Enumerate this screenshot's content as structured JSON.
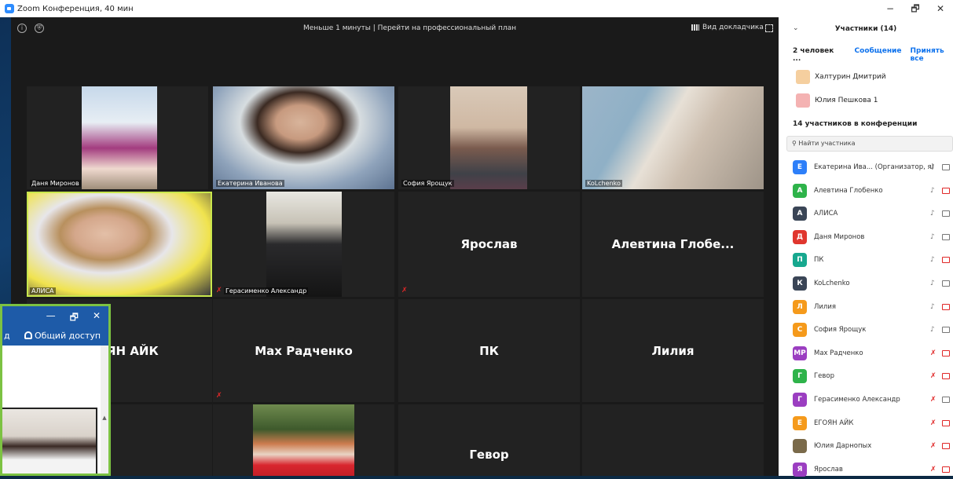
{
  "window": {
    "title": "Zoom Конференция, 40 мин",
    "minimize": "−",
    "maximize": "🗗",
    "close": "✕"
  },
  "meeting": {
    "info_icon": "i",
    "shield_icon": "⛨",
    "upgrade_msg": "Меньше 1 минуты | Перейти на профессиональный план",
    "speaker_view": "Вид докладчика"
  },
  "tiles": [
    {
      "name": "Даня Миронов"
    },
    {
      "name": "Екатерина Иванова"
    },
    {
      "name": "София Ярощук"
    },
    {
      "name": "KoLchenko"
    },
    {
      "name": "АЛИСА"
    },
    {
      "name": "Герасименко Александр"
    },
    {
      "center": "Ярослав"
    },
    {
      "center": "Алевтина  Глобе..."
    },
    {
      "center": "ЯН АЙК"
    },
    {
      "center": "Max Радченко"
    },
    {
      "center": "ПК"
    },
    {
      "center": "Лилия"
    },
    {
      "center": "Гевор"
    }
  ],
  "panel": {
    "title": "Участники (14)",
    "waiting_count": "2 человек ...",
    "message": "Сообщение",
    "admit_all": "Принять все",
    "waiting": [
      "Халтурин Дмитрий",
      "Юлия Пешкова 1"
    ],
    "in_conf": "14 участников в конференции",
    "search_placeholder": "Найти участника",
    "participants": [
      {
        "initial": "Е",
        "name": "Екатерина Ива... (Организатор, я)",
        "color": "#2d7ff9",
        "mic": "on",
        "cam": "on"
      },
      {
        "initial": "А",
        "name": "Алевтина Глобенко",
        "color": "#2eb34a",
        "mic": "on",
        "cam": "off"
      },
      {
        "initial": "А",
        "name": "АЛИСА",
        "color": "#3a4556",
        "mic": "on",
        "cam": "on"
      },
      {
        "initial": "Д",
        "name": "Даня Миронов",
        "color": "#e0362e",
        "mic": "on",
        "cam": "on"
      },
      {
        "initial": "П",
        "name": "ПК",
        "color": "#17a88f",
        "mic": "on",
        "cam": "off"
      },
      {
        "initial": "К",
        "name": "KoLchenko",
        "color": "#3a4556",
        "mic": "on",
        "cam": "on"
      },
      {
        "initial": "Л",
        "name": "Лилия",
        "color": "#f59a1b",
        "mic": "on",
        "cam": "off"
      },
      {
        "initial": "С",
        "name": "София Ярощук",
        "color": "#f59a1b",
        "mic": "on",
        "cam": "on"
      },
      {
        "initial": "MP",
        "name": "Max Радченко",
        "color": "#9b3ec1",
        "mic": "off",
        "cam": "off"
      },
      {
        "initial": "Г",
        "name": "Гевор",
        "color": "#2eb34a",
        "mic": "off",
        "cam": "off"
      },
      {
        "initial": "Г",
        "name": "Герасименко Александр",
        "color": "#9b3ec1",
        "mic": "off",
        "cam": "on"
      },
      {
        "initial": "Е",
        "name": "ЕГОЯН АЙК",
        "color": "#f59a1b",
        "mic": "off",
        "cam": "off"
      },
      {
        "initial": "",
        "name": "Юлия Дарнопых",
        "color": "#7a6a4a",
        "mic": "off",
        "cam": "off"
      },
      {
        "initial": "Я",
        "name": "Ярослав",
        "color": "#9b3ec1",
        "mic": "off",
        "cam": "off"
      }
    ]
  },
  "other_window": {
    "minimize": "—",
    "maximize": "🗗",
    "close": "✕",
    "left_text": "д",
    "share": "Общий доступ"
  }
}
